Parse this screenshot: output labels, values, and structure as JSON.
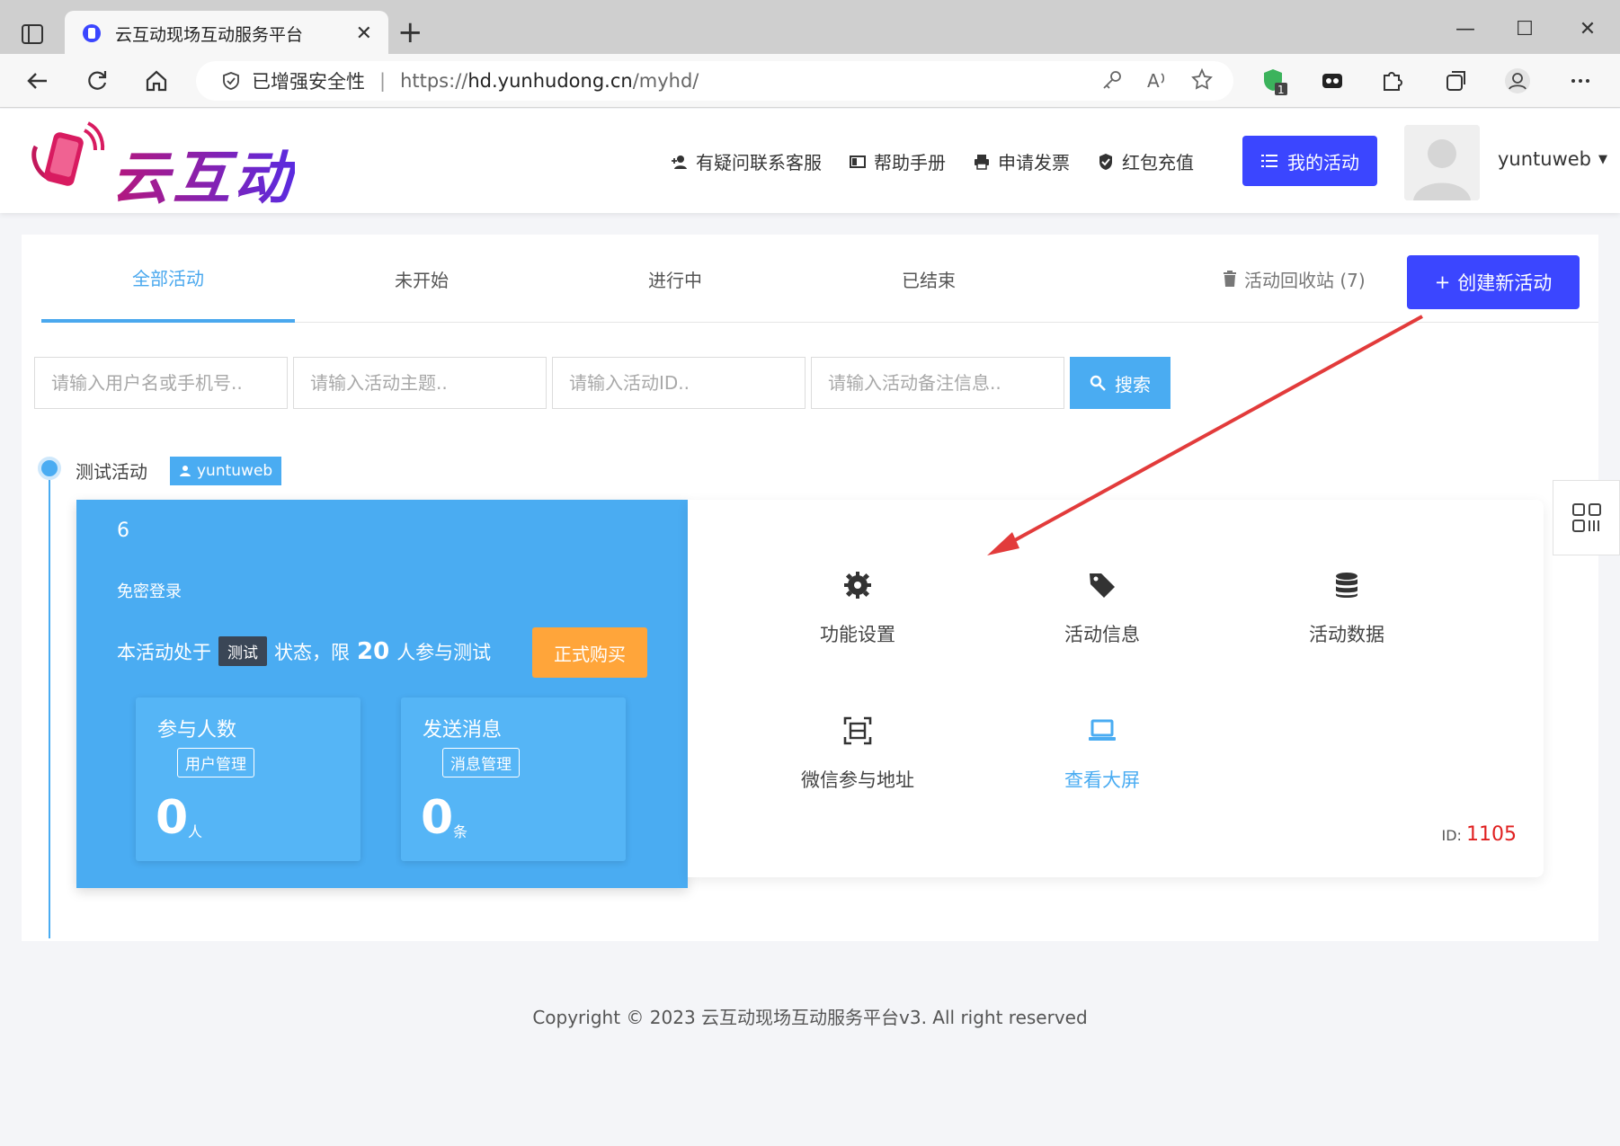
{
  "browser": {
    "tab_title": "云互动现场互动服务平台",
    "security_label": "已增强安全性",
    "url_prefix": "https://",
    "url_host": "hd.yunhudong.cn",
    "url_path": "/myhd/",
    "extension_badge": "1"
  },
  "header": {
    "logo_text": "云互动",
    "nav": {
      "contact": "有疑问联系客服",
      "help": "帮助手册",
      "invoice": "申请发票",
      "recharge": "红包充值"
    },
    "my_activity": "我的活动",
    "username": "yuntuweb"
  },
  "tabs": {
    "all": "全部活动",
    "not_started": "未开始",
    "in_progress": "进行中",
    "ended": "已结束",
    "recycle": "活动回收站 (7)",
    "create": "创建新活动"
  },
  "filters": {
    "user_placeholder": "请输入用户名或手机号..",
    "topic_placeholder": "请输入活动主题..",
    "id_placeholder": "请输入活动ID..",
    "note_placeholder": "请输入活动备注信息..",
    "search": "搜索"
  },
  "activity": {
    "name": "测试活动",
    "owner": "yuntuweb",
    "number": "6",
    "login_mode": "免密登录",
    "status_prefix": "本活动处于",
    "status_badge": "测试",
    "status_mid": "状态，限",
    "status_limit": "20",
    "status_suffix": "人参与测试",
    "buy": "正式购买",
    "participants": {
      "title": "参与人数",
      "link": "用户管理",
      "value": "0",
      "unit": "人"
    },
    "messages": {
      "title": "发送消息",
      "link": "消息管理",
      "value": "0",
      "unit": "条"
    },
    "functions": {
      "settings": "功能设置",
      "info": "活动信息",
      "data": "活动数据",
      "wechat": "微信参与地址",
      "screen": "查看大屏"
    },
    "id_label": "ID:",
    "id_value": "1105"
  },
  "footer": "Copyright © 2023 云互动现场互动服务平台v3. All right reserved",
  "colors": {
    "primary": "#3b46ff",
    "accent_blue": "#4aacf2",
    "orange": "#ffa53a",
    "id_red": "#e02020",
    "arrow_red": "#e23b3b"
  }
}
